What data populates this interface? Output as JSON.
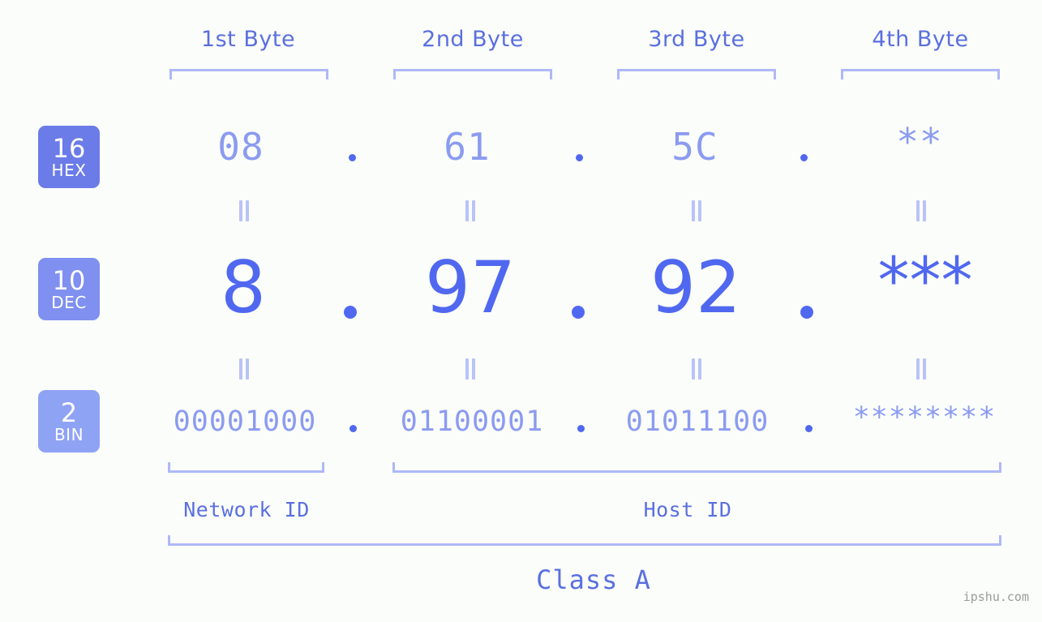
{
  "background_color": "#fbfdfa",
  "accent_colors": {
    "hex_badge": "#6b7ce8",
    "dec_badge": "#7f90f0",
    "bin_badge": "#8fa3f5",
    "hex_text": "#8b9bf0",
    "dec_text": "#5068f0",
    "bin_text": "#8b9bf0",
    "bracket": "#aeb9f7",
    "label_text": "#5a6fe0",
    "equals_mark": "#b9c3f8",
    "watermark": "#9b9b9b"
  },
  "byte_headers": [
    {
      "label": "1st Byte"
    },
    {
      "label": "2nd Byte"
    },
    {
      "label": "3rd Byte"
    },
    {
      "label": "4th Byte"
    }
  ],
  "bases": [
    {
      "number": "16",
      "name": "HEX"
    },
    {
      "number": "10",
      "name": "DEC"
    },
    {
      "number": "2",
      "name": "BIN"
    }
  ],
  "rows": {
    "hex": {
      "values": [
        "08",
        "61",
        "5C",
        "**"
      ],
      "separator": "."
    },
    "dec": {
      "values": [
        "8",
        "97",
        "92",
        "***"
      ],
      "separator": "."
    },
    "bin": {
      "values": [
        "00001000",
        "01100001",
        "01011100",
        "********"
      ],
      "separator": "."
    }
  },
  "equals_marks": {
    "symbol": "||",
    "count_per_row": 4
  },
  "segments": {
    "network_id": "Network ID",
    "host_id": "Host ID",
    "class": "Class A"
  },
  "watermark": "ipshu.com"
}
